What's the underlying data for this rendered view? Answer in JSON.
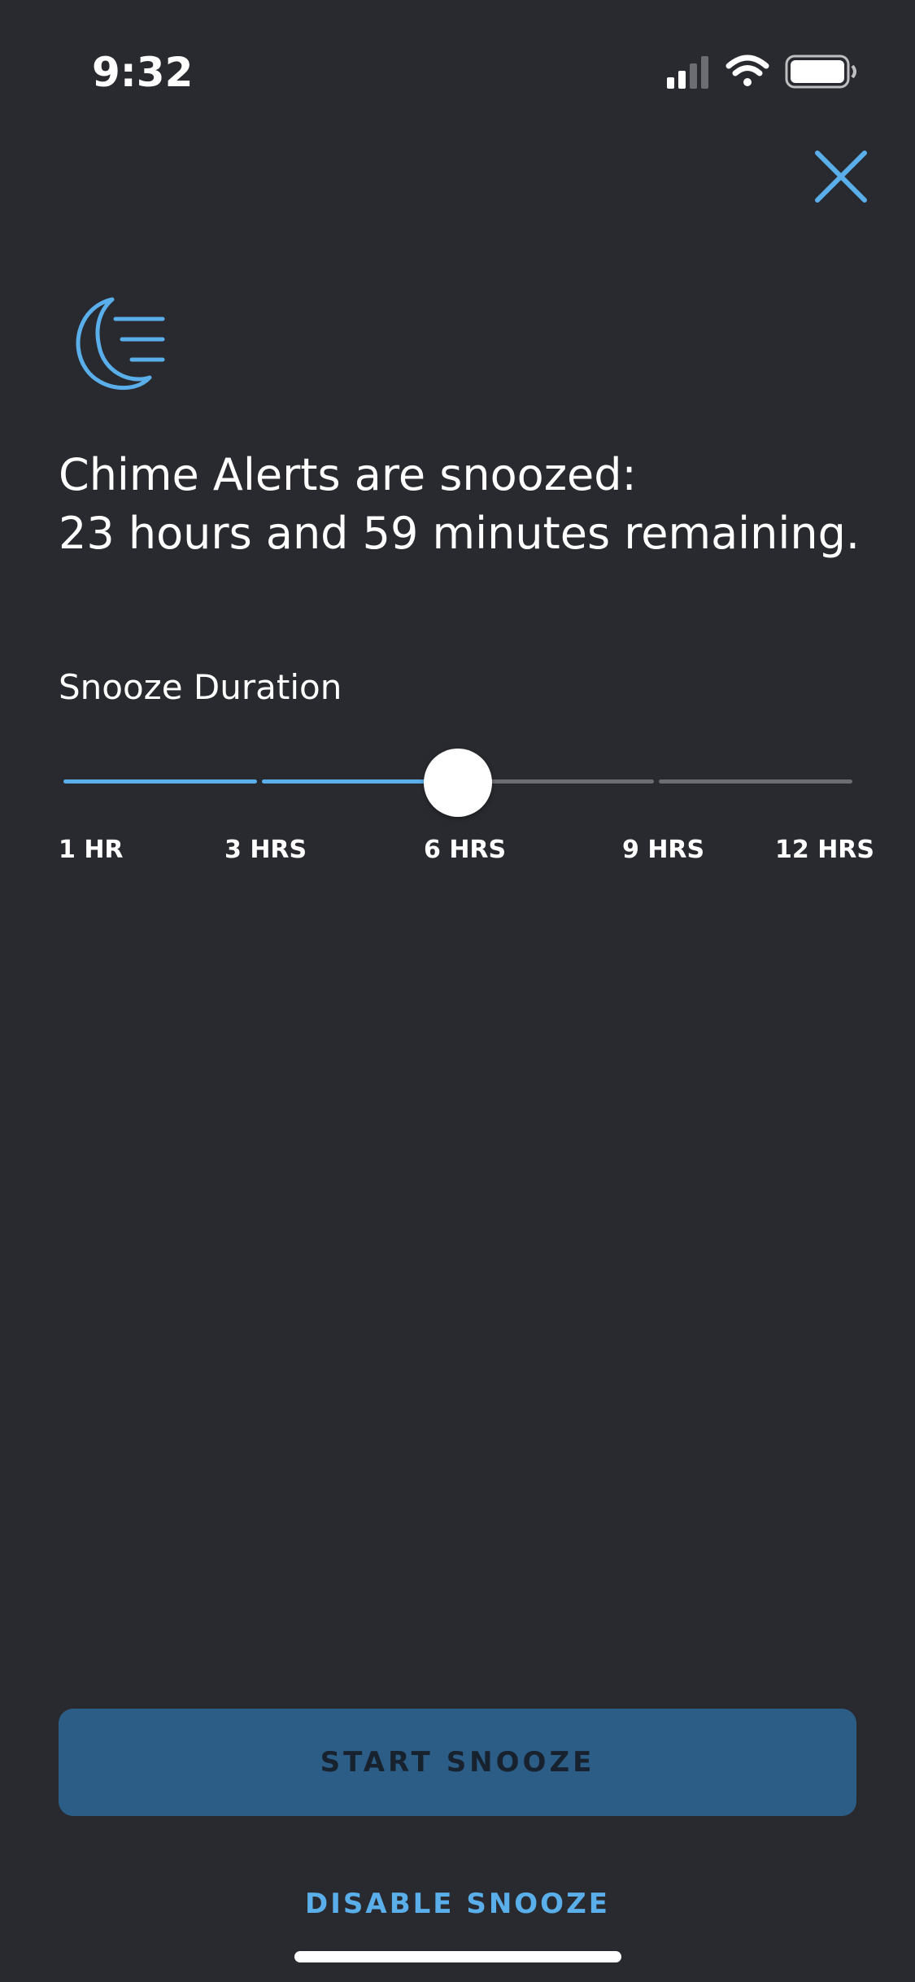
{
  "status_bar": {
    "time": "9:32",
    "signal_icon": "cellular-signal-icon",
    "wifi_icon": "wifi-icon",
    "battery_icon": "battery-icon"
  },
  "header": {
    "close_icon": "close-icon"
  },
  "hero": {
    "icon": "moon-snooze-icon",
    "headline_line1": "Chime Alerts are snoozed:",
    "headline_line2": "23 hours and 59 minutes remaining."
  },
  "snooze": {
    "label": "Snooze Duration",
    "options": [
      "1 HR",
      "3 HRS",
      "6 HRS",
      "9 HRS",
      "12 HRS"
    ],
    "selected_index": 2,
    "selected_value": "6 HRS"
  },
  "actions": {
    "start_label": "START SNOOZE",
    "disable_label": "DISABLE SNOOZE"
  },
  "colors": {
    "background": "#282a2f",
    "accent": "#5aaeea",
    "button_fill": "#2c5d86",
    "button_text": "#17222e",
    "track_inactive": "#6b6d72"
  }
}
